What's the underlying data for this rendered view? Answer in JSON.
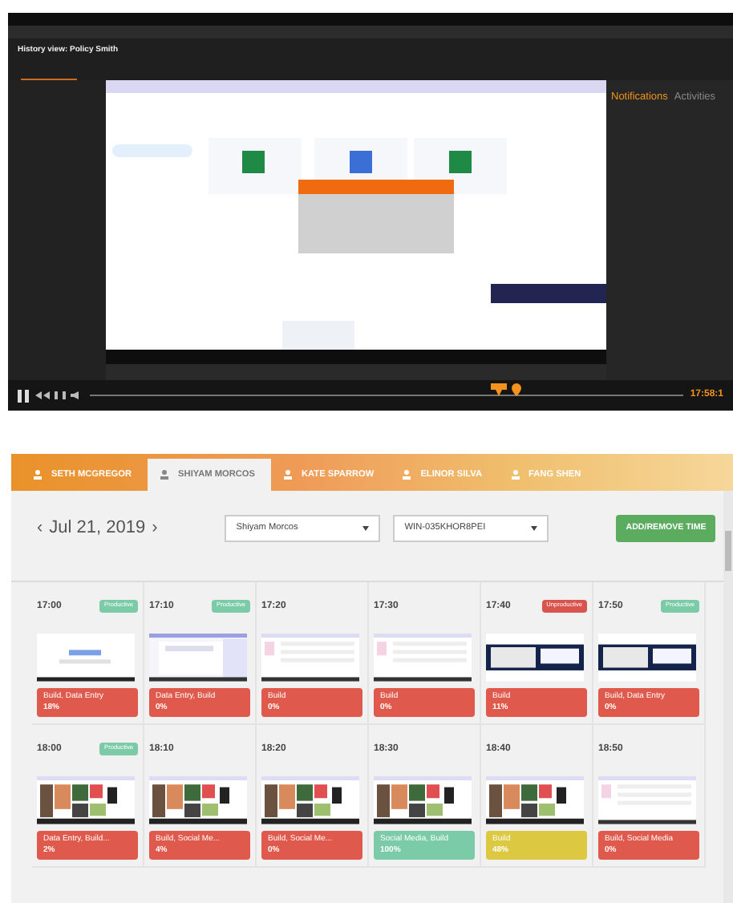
{
  "player": {
    "title": "History view: Policy Smith",
    "side_tabs": [
      {
        "label": "Notifications",
        "selected": true
      },
      {
        "label": "Activities",
        "selected": false
      }
    ],
    "time": "17:58:1"
  },
  "tabs": [
    {
      "label": "SETH MCGREGOR",
      "selected": false
    },
    {
      "label": "SHIYAM MORCOS",
      "selected": true
    },
    {
      "label": "KATE SPARROW",
      "selected": false
    },
    {
      "label": "ELINOR SILVA",
      "selected": false
    },
    {
      "label": "FANG SHEN",
      "selected": false
    }
  ],
  "toolbar": {
    "date": "Jul 21, 2019",
    "prev": "‹",
    "next": "›",
    "user_select": "Shiyam Morcos",
    "machine_select": "WIN-035KHOR8PEI",
    "button": "ADD/REMOVE TIME"
  },
  "rows": [
    {
      "slots": [
        {
          "time": "17:00",
          "badge": {
            "kind": "productive",
            "text": "Productive"
          },
          "categories": "Build, Data Entry",
          "percent": "18%",
          "color": "#df5a4c"
        },
        {
          "time": "17:10",
          "badge": {
            "kind": "productive",
            "text": "Productive"
          },
          "categories": "Data Entry, Build",
          "percent": "0%",
          "color": "#df5a4c"
        },
        {
          "time": "17:20",
          "categories": "Build",
          "percent": "0%",
          "color": "#df5a4c"
        },
        {
          "time": "17:30",
          "categories": "Build",
          "percent": "0%",
          "color": "#df5a4c"
        },
        {
          "time": "17:40",
          "badge": {
            "kind": "unproductive",
            "text": "Unproductive"
          },
          "categories": "Build",
          "percent": "11%",
          "color": "#df5a4c"
        },
        {
          "time": "17:50",
          "badge": {
            "kind": "productive",
            "text": "Productive"
          },
          "categories": "Build, Data Entry",
          "percent": "0%",
          "color": "#df5a4c"
        }
      ]
    },
    {
      "slots": [
        {
          "time": "18:00",
          "badge": {
            "kind": "productive",
            "text": "Productive"
          },
          "categories": "Data Entry, Build...",
          "percent": "2%",
          "color": "#df5a4c"
        },
        {
          "time": "18:10",
          "categories": "Build, Social Me...",
          "percent": "4%",
          "color": "#df5a4c"
        },
        {
          "time": "18:20",
          "categories": "Build, Social Me...",
          "percent": "0%",
          "color": "#df5a4c"
        },
        {
          "time": "18:30",
          "categories": "Social Media, Build",
          "percent": "100%",
          "color": "#7ccba8"
        },
        {
          "time": "18:40",
          "categories": "Build",
          "percent": "48%",
          "color": "#dcc841"
        },
        {
          "time": "18:50",
          "categories": "Build, Social Media",
          "percent": "0%",
          "color": "#df5a4c"
        }
      ]
    }
  ]
}
